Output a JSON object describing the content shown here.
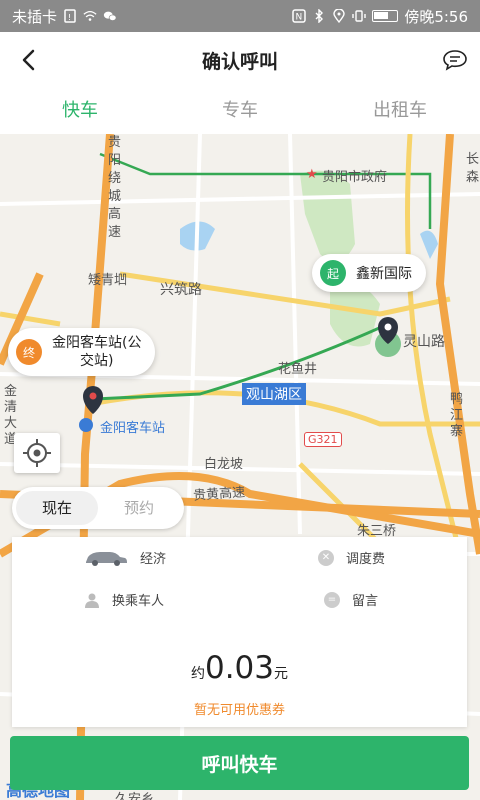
{
  "status_bar": {
    "carrier": "未插卡",
    "time": "傍晚5:56"
  },
  "nav": {
    "title": "确认呼叫"
  },
  "tabs": [
    {
      "label": "快车",
      "active": true
    },
    {
      "label": "专车",
      "active": false
    },
    {
      "label": "出租车",
      "active": false
    }
  ],
  "map": {
    "start": {
      "tag": "起",
      "name": "鑫新国际"
    },
    "end": {
      "tag": "终",
      "name_line1": "金阳客车站(公",
      "name_line2": "交站)"
    },
    "labels": {
      "government": "贵阳市政府",
      "district": "观山湖区",
      "road_xingzhu": "兴筑路",
      "road_lingshan": "灵山路",
      "road_guihuang": "贵黄高速",
      "huayujing": "花鱼井",
      "bailongpo": "白龙坡",
      "jinyang_station": "金阳客车站",
      "zhuqingwei": "矮青垇",
      "guiyang_ring": "贵阳绕城高速",
      "jinqing": "金清大道",
      "yajiang": "鸭江寨",
      "zhumaqiao": "朱三桥",
      "highway_g321": "G321",
      "chang": "长",
      "sen": "森"
    },
    "logo": "高德地图",
    "bottom_label": "久安乡",
    "colors": {
      "start": "#2db46b",
      "end": "#f08a2c"
    }
  },
  "time_toggle": {
    "now_label": "现在",
    "reserve_label": "预约"
  },
  "panel": {
    "car_type_label": "经济",
    "dispatch_fee_label": "调度费",
    "change_rider_label": "换乘车人",
    "message_label": "留言",
    "price_prefix": "约",
    "price_value": "0.03",
    "price_unit": "元",
    "coupon_note": "暂无可用优惠券"
  },
  "call_button": {
    "label": "呼叫快车"
  },
  "accent_color": "#2db46b"
}
